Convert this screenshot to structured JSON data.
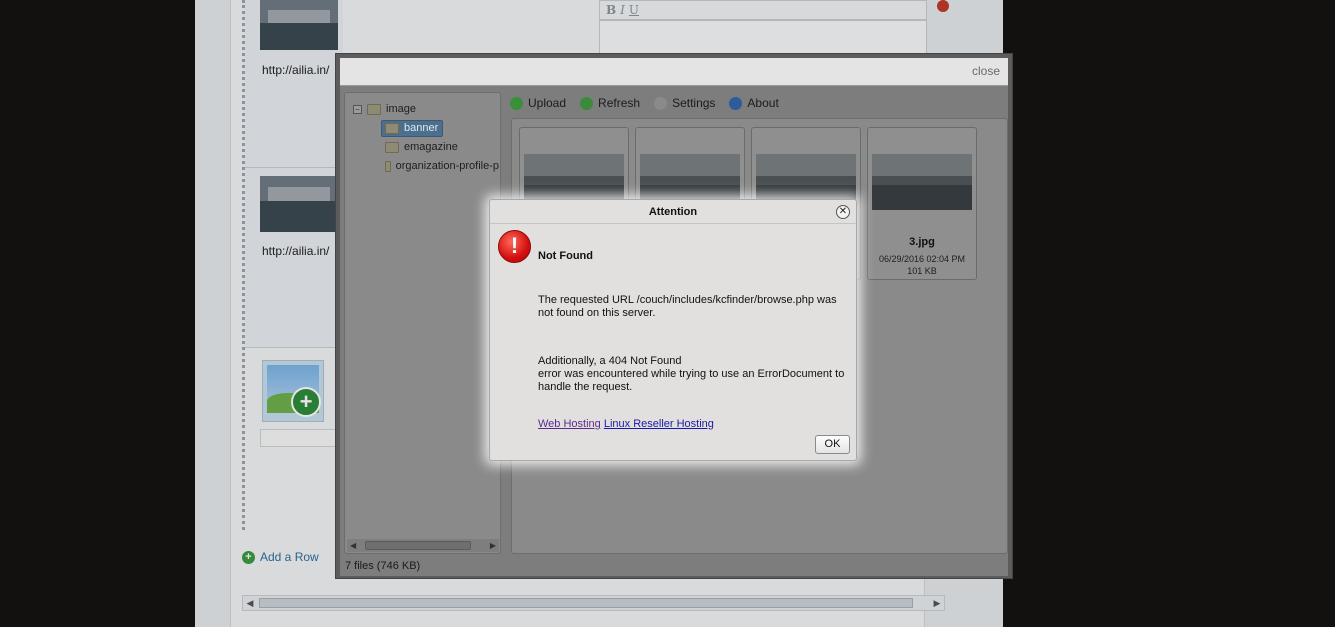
{
  "page": {
    "row_urls": [
      "http://ailia.in/",
      "http://ailia.in/"
    ],
    "add_row_label": "Add a Row",
    "rte_toolbar_buttons": [
      "B",
      "I",
      "U"
    ]
  },
  "kcfinder": {
    "close_label": "close",
    "toolbar": [
      {
        "label": "Upload",
        "icon": "upload-icon",
        "color": "#3a8f3a"
      },
      {
        "label": "Refresh",
        "icon": "refresh-icon",
        "color": "#3c8a3c"
      },
      {
        "label": "Settings",
        "icon": "gear-icon",
        "color": "#8a8a8a"
      },
      {
        "label": "About",
        "icon": "info-icon",
        "color": "#2e5c9a"
      }
    ],
    "tree": {
      "root": "image",
      "root_toggle": "−",
      "children": [
        "banner",
        "emagazine",
        "organization-profile-p"
      ],
      "selected": "banner"
    },
    "files": [
      {
        "name": "",
        "date": "",
        "size": ""
      },
      {
        "name": "",
        "date": "",
        "size": ""
      },
      {
        "name": "",
        "date": "",
        "size": ""
      },
      {
        "name": "3.jpg",
        "date": "06/29/2016 02:04 PM",
        "size": "101 KB"
      }
    ],
    "status": "7 files (746 KB)"
  },
  "dialog": {
    "title": "Attention",
    "close_glyph": "✕",
    "icon_glyph": "!",
    "heading": "Not Found",
    "message1": "The requested URL /couch/includes/kcfinder/browse.php was not found on this server.",
    "message2_line1": "Additionally, a 404 Not Found",
    "message2_line2": "error was encountered while trying to use an ErrorDocument to handle the request.",
    "link1": "Web Hosting",
    "link2": "Linux Reseller Hosting",
    "ok_label": "OK"
  }
}
